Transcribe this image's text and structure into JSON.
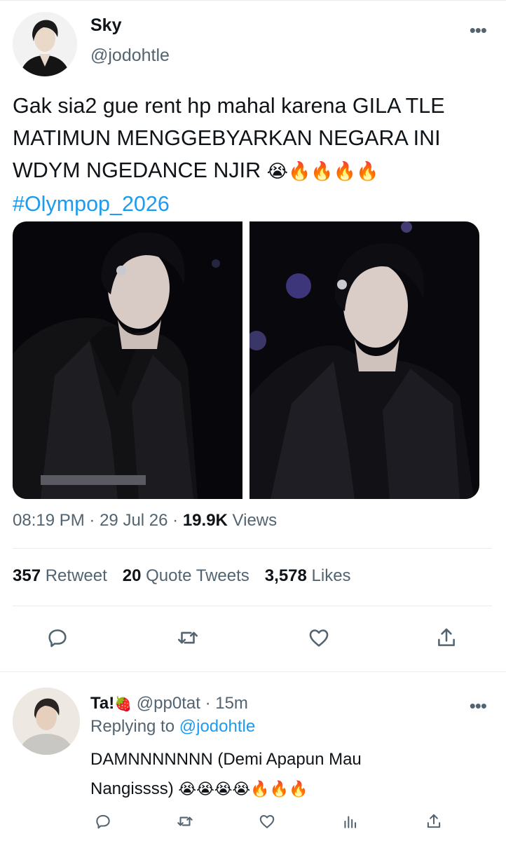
{
  "tweet": {
    "author_name": "Sky",
    "author_handle": "@jodohtle",
    "more_label": "•••",
    "text_lines": [
      "Gak sia2 gue rent hp mahal karena GILA TLE",
      "MATIMUN MENGGEBYARKAN NEGARA INI",
      "WDYM NGEDANCE NJIR"
    ],
    "text_emojis": "😭🔥🔥🔥🔥",
    "hashtag": "#Olympop_2026",
    "time": "08:19 PM",
    "date": "29 Jul 26",
    "separator": "·",
    "views_count": "19.9K",
    "views_label": "Views",
    "retweet_count": "357",
    "retweet_label": "Retweet",
    "quote_count": "20",
    "quote_label": "Quote Tweets",
    "likes_count": "3,578",
    "likes_label": "Likes",
    "actions": [
      "reply-icon",
      "retweet-icon",
      "like-icon",
      "share-icon"
    ]
  },
  "reply": {
    "author_name": "Ta!",
    "name_emoji": "🍓",
    "author_handle": "@pp0tat",
    "separator": "·",
    "time_ago": "15m",
    "more_label": "•••",
    "replying_prefix": "Replying to",
    "replying_to": "@jodohtle",
    "text_lines": [
      "DAMNNNNNNN (Demi Apapun Mau",
      "Nangissss)"
    ],
    "text_emojis": "😭😭😭😭🔥🔥🔥",
    "actions": [
      "reply-icon",
      "retweet-icon",
      "like-icon",
      "analytics-icon",
      "share-icon"
    ]
  },
  "colors": {
    "link": "#1d9bf0",
    "secondary_text": "#536471",
    "primary_text": "#0f1419",
    "divider": "#e6ecf0"
  }
}
